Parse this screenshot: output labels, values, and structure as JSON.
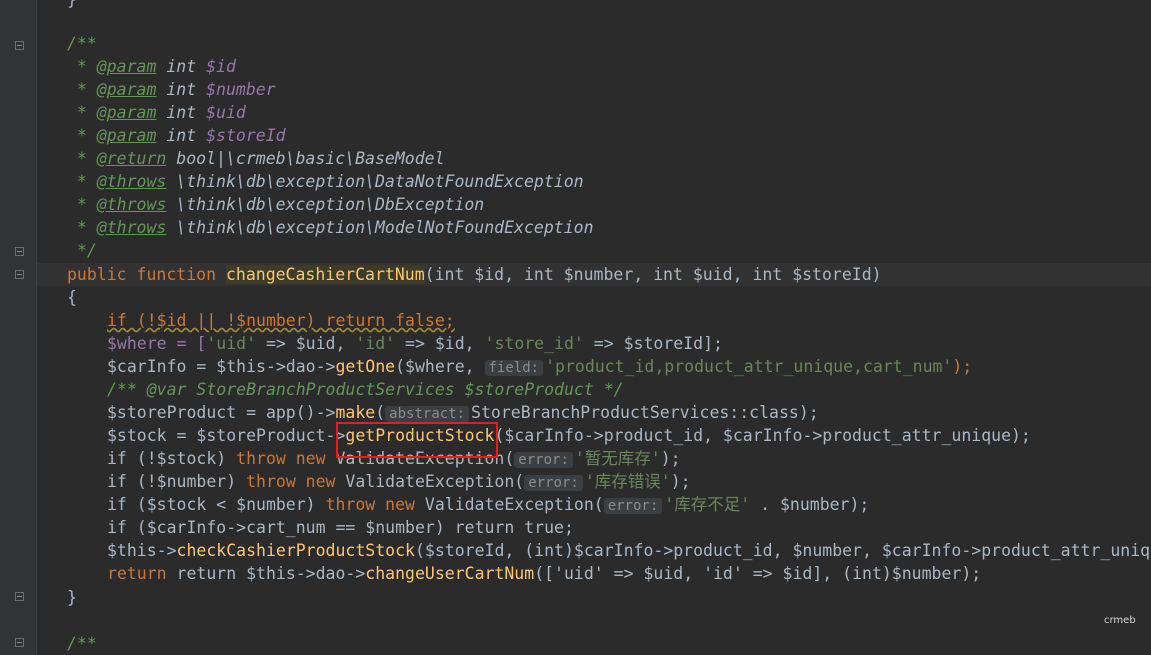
{
  "editor": {
    "lines": {
      "l0": "}",
      "doc_open": "/**",
      "param1_tag": "@param",
      "param1_type": "int",
      "param1_var": "$id",
      "param2_tag": "@param",
      "param2_type": "int",
      "param2_var": "$number",
      "param3_tag": "@param",
      "param3_type": "int",
      "param3_var": "$uid",
      "param4_tag": "@param",
      "param4_type": "int",
      "param4_var": "$storeId",
      "return_tag": "@return",
      "return_type": "bool|\\crmeb\\basic\\BaseModel",
      "throws1_tag": "@throws",
      "throws1_type": "\\think\\db\\exception\\DataNotFoundException",
      "throws2_tag": "@throws",
      "throws2_type": "\\think\\db\\exception\\DbException",
      "throws3_tag": "@throws",
      "throws3_type": "\\think\\db\\exception\\ModelNotFoundException",
      "doc_close": "*/",
      "sig_kw": "public function ",
      "sig_name": "changeCashierCartNum",
      "sig_params": "(int $id, int $number, int $uid, int $storeId)",
      "brace_open": "{",
      "if1": "if (!$id || !$number) return false;",
      "where_1": "$where = [",
      "where_s1": "'uid'",
      "where_2": " => $uid, ",
      "where_s2": "'id'",
      "where_3": " => $id, ",
      "where_s3": "'store_id'",
      "where_4": " => $storeId];",
      "carinfo_1": "$carInfo = $this->dao->",
      "carinfo_fn": "getOne",
      "carinfo_2": "($where, ",
      "carinfo_hint": "field:",
      "carinfo_str": "'product_id,product_attr_unique,cart_num'",
      "carinfo_3": ");",
      "var_doc": "/** @var StoreBranchProductServices $storeProduct */",
      "make_1": "$storeProduct = app()->",
      "make_fn": "make",
      "make_2": "(",
      "make_hint": "abstract:",
      "make_3": "StoreBranchProductServices::class);",
      "stock_1": "$stock = $storeProduct->",
      "stock_fn": "getProductStock",
      "stock_2": "($carInfo->product_id, $carInfo->product_attr_unique);",
      "if2_1": "if (!$stock) ",
      "if2_kw": "throw new ",
      "if2_cls": "ValidateException(",
      "if2_hint": "error:",
      "if2_str": "'暂无库存'",
      "if2_end": ");",
      "if3_1": "if (!$number) ",
      "if3_kw": "throw new ",
      "if3_cls": "ValidateException(",
      "if3_hint": "error:",
      "if3_str": "'库存错误'",
      "if3_end": ");",
      "if4_1": "if ($stock < $number) ",
      "if4_kw": "throw new ",
      "if4_cls": "ValidateException(",
      "if4_hint": "error:",
      "if4_str": "'库存不足'",
      "if4_end": " . $number);",
      "if5": "if ($carInfo->cart_num == $number) return true;",
      "check_1": "$this->",
      "check_fn": "checkCashierProductStock",
      "check_2": "($storeId, (int)$carInfo->product_id, $number, $carInfo->product_attr_uniq",
      "ret_1": "return $this->dao->",
      "ret_fn": "changeUserCartNum",
      "ret_2": "(['uid' => $uid, 'id' => $id], (int)$number);",
      "brace_close": "}",
      "doc_open2": "/**"
    }
  },
  "watermark": "crmeb",
  "colors": {
    "background": "#2b2b2b",
    "keyword": "#cc7832",
    "function": "#ffc66d",
    "variable": "#9876aa",
    "string": "#6a8759",
    "comment": "#629755",
    "highlight_box": "#e02020"
  }
}
